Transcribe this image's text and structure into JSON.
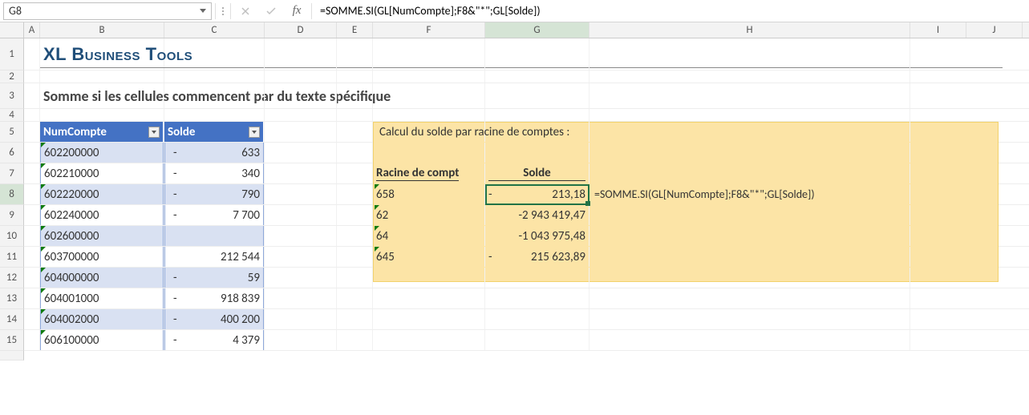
{
  "formula_bar": {
    "cell_ref": "G8",
    "formula": "=SOMME.SI(GL[NumCompte];F8&\"*\";GL[Solde])"
  },
  "columns": [
    "A",
    "B",
    "C",
    "D",
    "E",
    "F",
    "G",
    "H",
    "I",
    "J"
  ],
  "active_column": "G",
  "active_row": 8,
  "title": "XL Business Tools",
  "subtitle": "Somme si les cellules commencent par du texte spécifique",
  "table": {
    "headers": {
      "numcompte": "NumCompte",
      "solde": "Solde"
    },
    "rows": [
      {
        "num": "602200000",
        "neg": "-",
        "val": "633",
        "even": true
      },
      {
        "num": "602210000",
        "neg": "-",
        "val": "340",
        "even": false
      },
      {
        "num": "602220000",
        "neg": "-",
        "val": "790",
        "even": true
      },
      {
        "num": "602240000",
        "neg": "-",
        "val": "7 700",
        "even": false
      },
      {
        "num": "602600000",
        "neg": "",
        "val": "",
        "even": true
      },
      {
        "num": "603700000",
        "neg": "",
        "val": "212 544",
        "even": false
      },
      {
        "num": "604000000",
        "neg": "-",
        "val": "59",
        "even": true
      },
      {
        "num": "604001000",
        "neg": "-",
        "val": "918 839",
        "even": false
      },
      {
        "num": "604002000",
        "neg": "-",
        "val": "400 200",
        "even": true
      },
      {
        "num": "606100000",
        "neg": "-",
        "val": "4 379",
        "even": false
      }
    ]
  },
  "yellow_box": {
    "title": "Calcul du solde par racine de comptes :",
    "headers": {
      "racine": "Racine de compt",
      "solde": "Solde"
    },
    "rows": [
      {
        "racine": "658",
        "neg": "-",
        "val": "213,18",
        "formula": "=SOMME.SI(GL[NumCompte];F8&\"*\";GL[Solde])"
      },
      {
        "racine": "62",
        "neg": "",
        "val": "-2 943 419,47",
        "formula": ""
      },
      {
        "racine": "64",
        "neg": "",
        "val": "-1 043 975,48",
        "formula": ""
      },
      {
        "racine": "645",
        "neg": "-",
        "val": "215 623,89",
        "formula": ""
      }
    ]
  },
  "chart_data": {
    "type": "table",
    "title": "GL data with SUMIF by account root",
    "left_table": {
      "columns": [
        "NumCompte",
        "Solde"
      ],
      "rows": [
        [
          "602200000",
          -633
        ],
        [
          "602210000",
          -340
        ],
        [
          "602220000",
          -790
        ],
        [
          "602240000",
          -7700
        ],
        [
          "602600000",
          null
        ],
        [
          "603700000",
          212544
        ],
        [
          "604000000",
          -59
        ],
        [
          "604001000",
          -918839
        ],
        [
          "604002000",
          -400200
        ],
        [
          "606100000",
          -4379
        ]
      ]
    },
    "summary_table": {
      "columns": [
        "Racine de compte",
        "Solde"
      ],
      "rows": [
        [
          "658",
          -213.18
        ],
        [
          "62",
          -2943419.47
        ],
        [
          "64",
          -1043975.48
        ],
        [
          "645",
          -215623.89
        ]
      ]
    }
  }
}
